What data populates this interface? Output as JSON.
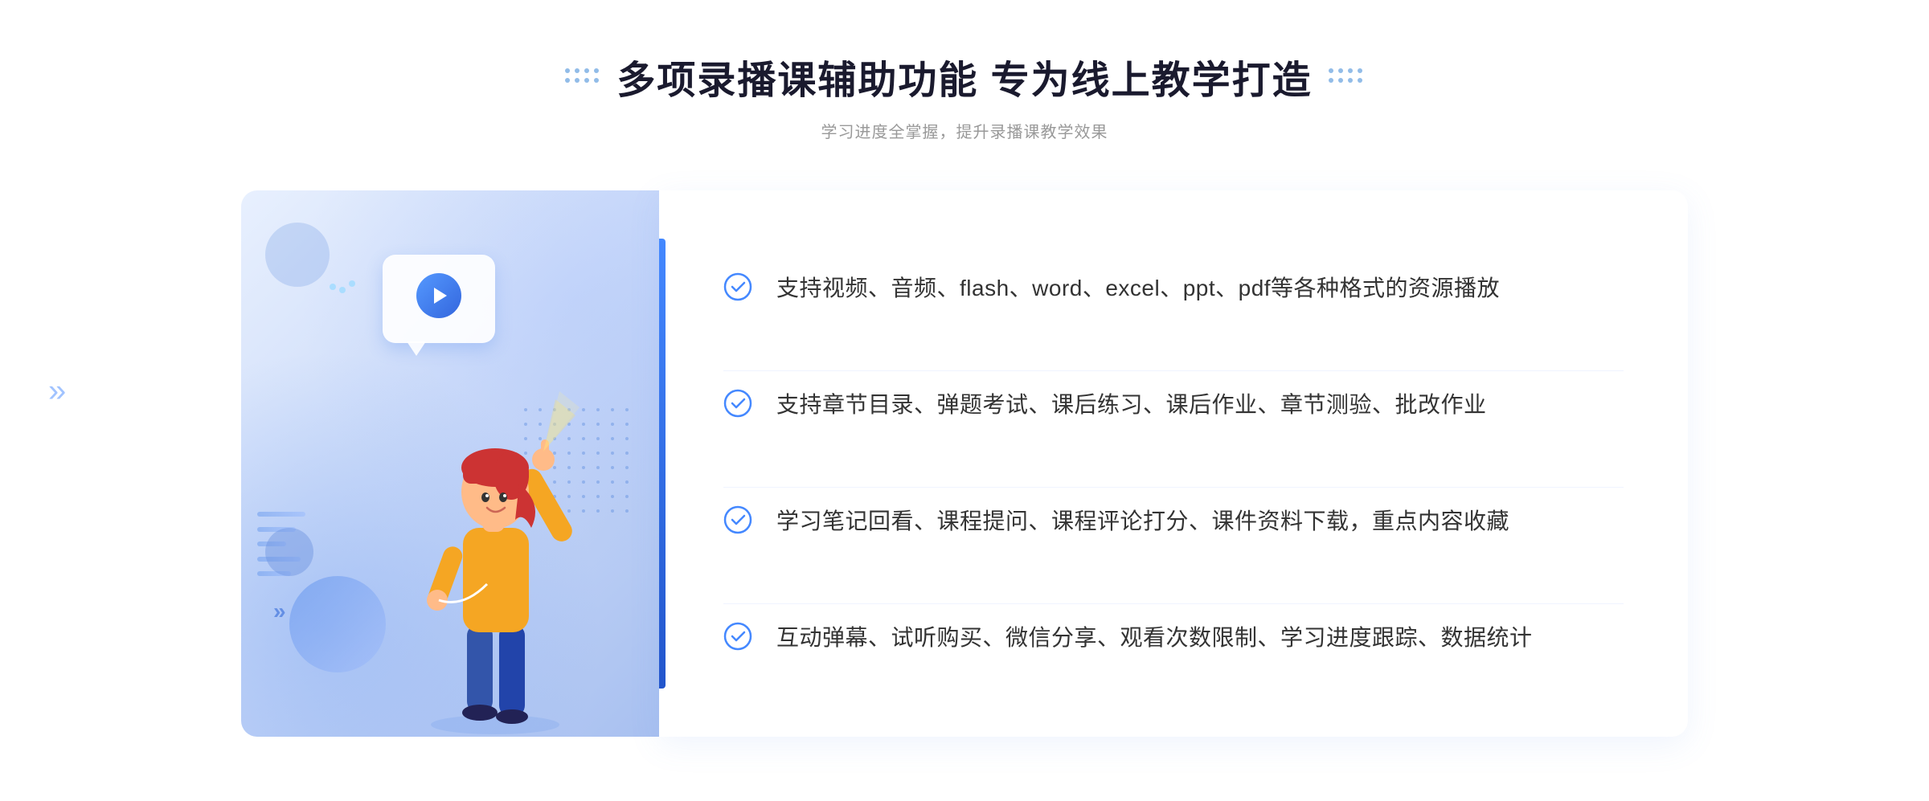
{
  "header": {
    "title": "多项录播课辅助功能 专为线上教学打造",
    "subtitle": "学习进度全掌握，提升录播课教学效果"
  },
  "features": [
    {
      "id": "feature-1",
      "text": "支持视频、音频、flash、word、excel、ppt、pdf等各种格式的资源播放"
    },
    {
      "id": "feature-2",
      "text": "支持章节目录、弹题考试、课后练习、课后作业、章节测验、批改作业"
    },
    {
      "id": "feature-3",
      "text": "学习笔记回看、课程提问、课程评论打分、课件资料下载，重点内容收藏"
    },
    {
      "id": "feature-4",
      "text": "互动弹幕、试听购买、微信分享、观看次数限制、学习进度跟踪、数据统计"
    }
  ],
  "decorations": {
    "dots_left": "❮❮",
    "left_arrow": "»"
  }
}
